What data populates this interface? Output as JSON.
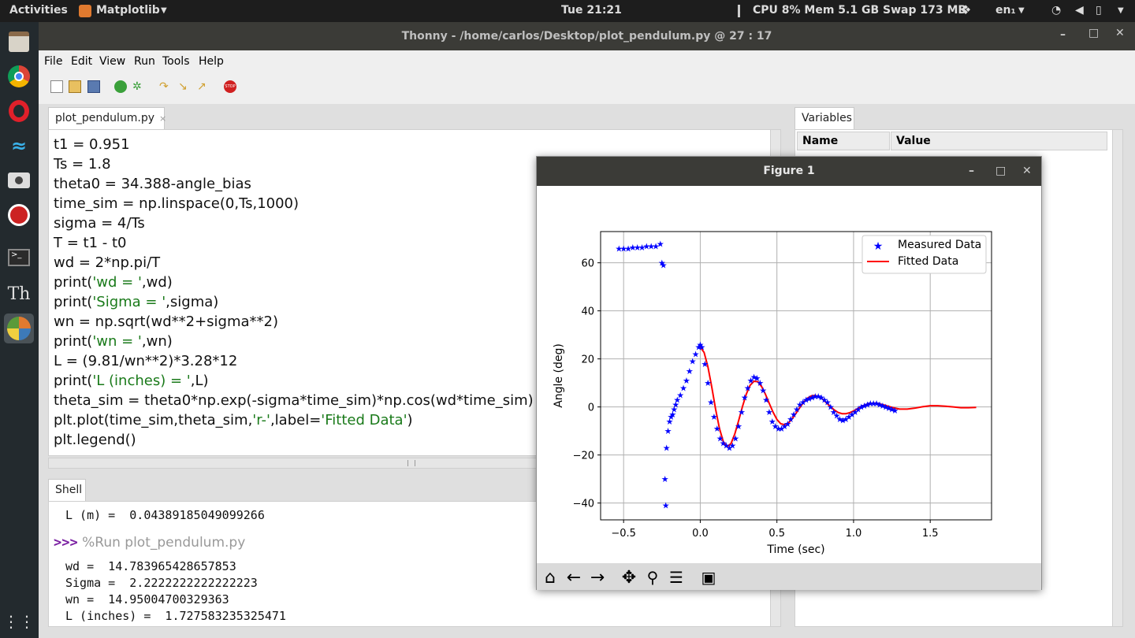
{
  "topbar": {
    "activities": "Activities",
    "app": "Matplotlib",
    "clock": "Tue 21:21",
    "sysmon": "CPU 8% Mem 5.1 GB Swap 173 MB",
    "lang": "en₁"
  },
  "window": {
    "title": "Thonny  -  /home/carlos/Desktop/plot_pendulum.py  @  27 : 17"
  },
  "menu": [
    "File",
    "Edit",
    "View",
    "Run",
    "Tools",
    "Help"
  ],
  "editor": {
    "tab": "plot_pendulum.py",
    "lines": [
      "t1 = 0.951",
      "Ts = 1.8",
      "theta0 = 34.388-angle_bias",
      "time_sim = np.linspace(0,Ts,1000)",
      "sigma = 4/Ts",
      "T = t1 - t0",
      "wd = 2*np.pi/T",
      "print('wd = ',wd)",
      "print('Sigma = ',sigma)",
      "wn = np.sqrt(wd**2+sigma**2)",
      "print('wn = ',wn)",
      "L = (9.81/wn**2)*3.28*12",
      "print('L (inches) = ',L)",
      "theta_sim = theta0*np.exp(-sigma*time_sim)*np.cos(wd*time_sim)",
      "plt.plot(time_sim,theta_sim,'r-',label='Fitted Data')",
      "plt.legend()"
    ]
  },
  "shell": {
    "tab": "Shell",
    "prev": "L (m) =  0.04389185049099266",
    "prompt": ">>>",
    "cmd": "%Run plot_pendulum.py",
    "out": [
      "wd =  14.783965428657853",
      "Sigma =  2.2222222222222223",
      "wn =  14.95004700329363",
      "L (inches) =  1.727583235325471"
    ]
  },
  "variables": {
    "tab": "Variables",
    "col_name": "Name",
    "col_value": "Value"
  },
  "figure": {
    "title": "Figure 1"
  },
  "chart_data": {
    "type": "line",
    "xlabel": "Time (sec)",
    "ylabel": "Angle (deg)",
    "xlim": [
      -0.65,
      1.9
    ],
    "ylim": [
      -47,
      73
    ],
    "xticks": [
      "−0.5",
      "0.0",
      "0.5",
      "1.0",
      "1.5"
    ],
    "yticks": [
      "−40",
      "−20",
      "0",
      "20",
      "40",
      "60"
    ],
    "grid": true,
    "legend_position": "top-right",
    "series": [
      {
        "name": "Measured Data",
        "kind": "scatter",
        "marker": "star",
        "color": "#0000ff",
        "x": [
          -0.53,
          -0.5,
          -0.47,
          -0.44,
          -0.41,
          -0.38,
          -0.35,
          -0.32,
          -0.29,
          -0.26,
          -0.25,
          -0.24,
          -0.23,
          -0.225,
          -0.22,
          -0.21,
          -0.2,
          -0.19,
          -0.18,
          -0.17,
          -0.16,
          -0.15,
          -0.13,
          -0.11,
          -0.09,
          -0.07,
          -0.05,
          -0.03,
          -0.01,
          0.0,
          0.01,
          0.03,
          0.05,
          0.07,
          0.09,
          0.11,
          0.13,
          0.15,
          0.17,
          0.19,
          0.21,
          0.23,
          0.25,
          0.27,
          0.29,
          0.31,
          0.33,
          0.35,
          0.37,
          0.39,
          0.41,
          0.43,
          0.45,
          0.47,
          0.49,
          0.51,
          0.53,
          0.55,
          0.57,
          0.59,
          0.61,
          0.63,
          0.65,
          0.67,
          0.69,
          0.71,
          0.73,
          0.75,
          0.77,
          0.79,
          0.81,
          0.83,
          0.85,
          0.87,
          0.89,
          0.91,
          0.93,
          0.95,
          0.97,
          0.99,
          1.01,
          1.03,
          1.05,
          1.07,
          1.09,
          1.11,
          1.13,
          1.15,
          1.17,
          1.19,
          1.21,
          1.23,
          1.25,
          1.27
        ],
        "y": [
          66,
          66,
          66,
          66.5,
          66.5,
          66.5,
          67,
          67,
          67,
          68,
          60,
          59,
          -30,
          -41,
          -17,
          -10,
          -6,
          -4,
          -3,
          -1,
          1,
          3,
          5,
          8,
          11,
          15,
          19,
          22,
          25,
          26,
          25,
          18,
          10,
          2,
          -4,
          -9,
          -13,
          -15,
          -16,
          -17,
          -16,
          -13,
          -8,
          -2,
          4,
          8,
          11,
          12.5,
          12,
          10,
          7,
          3,
          -2,
          -6,
          -8,
          -9,
          -9,
          -8,
          -7,
          -5,
          -3,
          -1,
          1,
          2,
          3,
          3.5,
          4,
          4.5,
          4.5,
          4,
          3,
          2,
          0,
          -2,
          -3.5,
          -5,
          -5.5,
          -5,
          -4,
          -3,
          -2,
          -1,
          0,
          0.5,
          1,
          1.5,
          1.5,
          1.5,
          1,
          0.5,
          0,
          -0.5,
          -1,
          -1.5
        ]
      },
      {
        "name": "Fitted Data",
        "kind": "line",
        "color": "#ff0000",
        "x": [
          0.0,
          0.025,
          0.05,
          0.075,
          0.1,
          0.125,
          0.15,
          0.175,
          0.2,
          0.225,
          0.25,
          0.275,
          0.3,
          0.325,
          0.35,
          0.375,
          0.4,
          0.425,
          0.45,
          0.475,
          0.5,
          0.525,
          0.55,
          0.575,
          0.6,
          0.625,
          0.65,
          0.675,
          0.7,
          0.725,
          0.75,
          0.775,
          0.8,
          0.825,
          0.85,
          0.875,
          0.9,
          0.925,
          0.95,
          0.975,
          1.0,
          1.05,
          1.1,
          1.15,
          1.2,
          1.25,
          1.3,
          1.35,
          1.4,
          1.45,
          1.5,
          1.55,
          1.6,
          1.65,
          1.7,
          1.75,
          1.8
        ],
        "y": [
          24.9,
          22.7,
          16.7,
          8.3,
          -0.9,
          -8.9,
          -14.4,
          -16.5,
          -15.3,
          -11.3,
          -5.8,
          0.1,
          5.3,
          9.0,
          10.7,
          10.5,
          8.5,
          5.3,
          1.5,
          -2.2,
          -5.2,
          -7.0,
          -7.4,
          -6.7,
          -4.9,
          -2.6,
          -0.2,
          2.0,
          3.7,
          4.6,
          4.8,
          4.2,
          3.1,
          1.6,
          0.1,
          -1.3,
          -2.3,
          -2.8,
          -2.8,
          -2.4,
          -1.7,
          0.2,
          1.5,
          1.6,
          0.8,
          -0.2,
          -0.9,
          -0.9,
          -0.5,
          0.1,
          0.5,
          0.5,
          0.3,
          -0.0,
          -0.3,
          -0.3,
          -0.2
        ]
      }
    ]
  },
  "toolbar_icons": [
    "new-icon",
    "open-icon",
    "save-icon",
    "run-icon",
    "debug-icon",
    "step-over-icon",
    "step-into-icon",
    "step-out-icon",
    "stop-icon"
  ],
  "fig_toolbar_icons": [
    "home-icon",
    "back-icon",
    "forward-icon",
    "pan-icon",
    "zoom-icon",
    "configure-icon",
    "save-figure-icon"
  ]
}
